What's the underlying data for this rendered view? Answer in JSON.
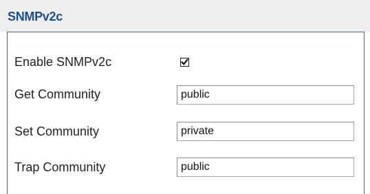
{
  "section": {
    "title": "SNMPv2c"
  },
  "enable": {
    "label": "Enable SNMPv2c",
    "checked": true
  },
  "fields": [
    {
      "label": "Get Community",
      "value": "public"
    },
    {
      "label": "Set Community",
      "value": "private"
    },
    {
      "label": "Trap Community",
      "value": "public"
    }
  ],
  "colors": {
    "title": "#1f4f86",
    "header_bg": "#efefef",
    "panel_border": "#4a6e93"
  }
}
